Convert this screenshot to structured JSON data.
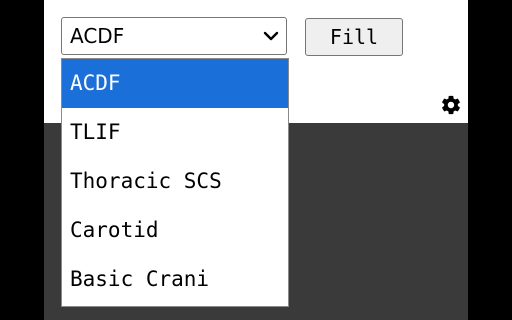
{
  "procedure_select": {
    "value": "ACDF",
    "options": [
      "ACDF",
      "TLIF",
      "Thoracic SCS",
      "Carotid",
      "Basic Crani"
    ],
    "selected_index": 0
  },
  "fill_button": {
    "label": "Fill"
  },
  "settings": {
    "icon": "gear-icon"
  },
  "colors": {
    "highlight": "#1a6fd8",
    "dark_area": "#3a3a3a",
    "frame": "#000000"
  }
}
